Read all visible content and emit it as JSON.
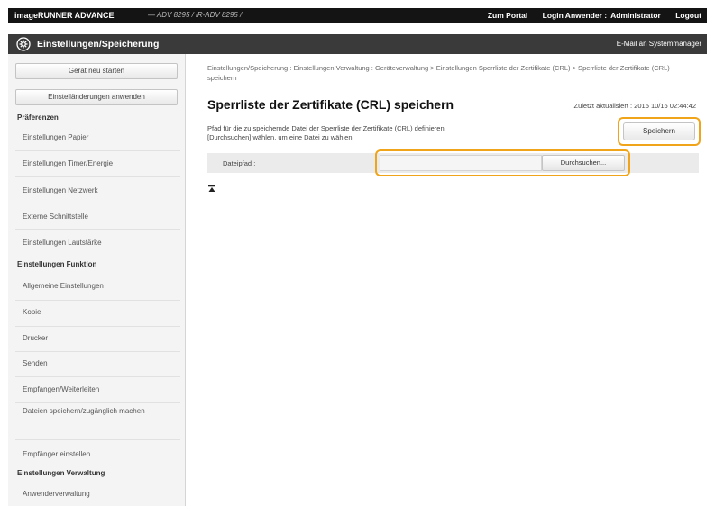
{
  "header": {
    "brand": "imageRUNNER ADVANCE",
    "device_name": "— ADV 8295 / iR-ADV 8295 /",
    "links": {
      "portal": "Zum Portal",
      "login_user_label": "Login Anwender :",
      "user": "Administrator",
      "logout": "Logout"
    }
  },
  "titlebar": {
    "icon": "gear-icon",
    "title": "Einstellungen/Speicherung",
    "mail_link": "E-Mail an Systemmanager"
  },
  "sidebar": {
    "restart_button": "Gerät neu starten",
    "apply_button": "Einstelländerungen anwenden",
    "sections": [
      {
        "heading": "Präferenzen",
        "items": [
          "Einstellungen Papier",
          "Einstellungen Timer/Energie",
          "Einstellungen Netzwerk",
          "Externe Schnittstelle",
          "Einstellungen Lautstärke"
        ]
      },
      {
        "heading": "Einstellungen Funktion",
        "items": [
          "Allgemeine Einstellungen",
          "Kopie",
          "Drucker",
          "Senden",
          "Empfangen/Weiterleiten",
          "Dateien speichern/zugänglich machen",
          "Empfänger einstellen"
        ]
      },
      {
        "heading": "Einstellungen Verwaltung",
        "items": [
          "Anwenderverwaltung"
        ]
      }
    ]
  },
  "main": {
    "breadcrumb": "Einstellungen/Speicherung : Einstellungen Verwaltung : Geräteverwaltung > Einstellungen Sperrliste der Zertifikate (CRL) > Sperrliste der Zertifikate (CRL) speichern",
    "page_title": "Sperrliste der Zertifikate (CRL) speichern",
    "last_updated": "Zuletzt aktualisiert : 2015 10/16 02:44:42",
    "description_line1": "Pfad für die zu speichernde Datei der Sperrliste der Zertifikate (CRL) definieren.",
    "description_line2": "[Durchsuchen] wählen, um eine Datei zu wählen.",
    "save_button": "Speichern",
    "filepath_label": "Dateipfad :",
    "filepath_value": "",
    "browse_button": "Durchsuchen...",
    "highlight_color": "#f0a41a"
  }
}
